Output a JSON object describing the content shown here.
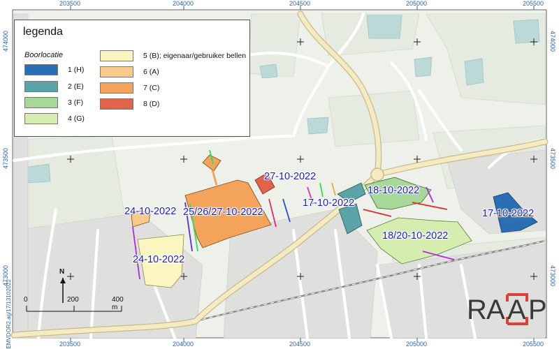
{
  "map": {
    "x_coords": [
      "203500",
      "204000",
      "204500",
      "205000",
      "205500"
    ],
    "y_coords": [
      "474000",
      "473500",
      "473000"
    ],
    "side_text": "EMVDOR2.ag/17/13102022",
    "colors": {
      "background": "#eef0ea",
      "road_major": "#f1e6b8",
      "road_minor": "#ffffff",
      "water": "#bcd9d7",
      "label_blue": "#1a1ad0"
    }
  },
  "legend": {
    "title": "legenda",
    "subtitle": "Boorlocatie",
    "items": [
      {
        "label": "1 (H)",
        "color": "#2a6fb3"
      },
      {
        "label": "2 (E)",
        "color": "#5aa3a6"
      },
      {
        "label": "3 (F)",
        "color": "#a8d79a"
      },
      {
        "label": "4 (G)",
        "color": "#d6edb0"
      },
      {
        "label": "5 (B); eigenaar/gebruiker bellen",
        "color": "#fbf6c0"
      },
      {
        "label": "6 (A)",
        "color": "#f7c98a"
      },
      {
        "label": "7 (C)",
        "color": "#f4a35a"
      },
      {
        "label": "8 (D)",
        "color": "#e0634a"
      }
    ]
  },
  "date_labels": [
    {
      "text": "27-10-2022"
    },
    {
      "text": "24-10-2022"
    },
    {
      "text": "25/26/27-10-2022"
    },
    {
      "text": "17-10-2022"
    },
    {
      "text": "18-10-2022"
    },
    {
      "text": "18/20-10-2022"
    },
    {
      "text": "17-10-2022"
    },
    {
      "text": "24-10-2022"
    }
  ],
  "scale": {
    "labels": [
      "0",
      "200",
      "400 m"
    ]
  },
  "north": {
    "label": "N"
  },
  "logo": {
    "letters": [
      "R",
      "A",
      "A",
      "P"
    ],
    "accent": "#e0403a"
  }
}
